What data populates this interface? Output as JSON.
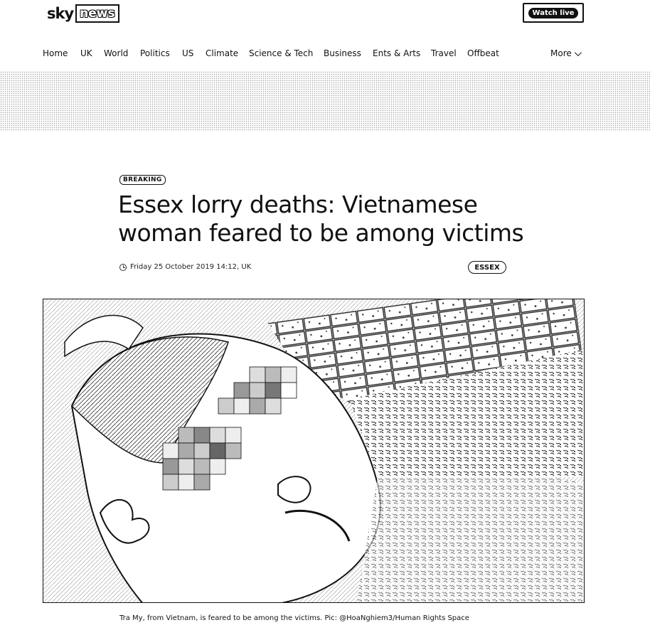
{
  "brand": {
    "sky": "sky",
    "news": "news"
  },
  "header": {
    "watch_live": "Watch live"
  },
  "nav": {
    "items": [
      "Home",
      "UK",
      "World",
      "Politics",
      "US",
      "Climate",
      "Science & Tech",
      "Business",
      "Ents & Arts",
      "Travel",
      "Offbeat"
    ],
    "more": "More"
  },
  "article": {
    "badge": "BREAKING",
    "headline": "Essex lorry deaths: Vietnamese woman feared to be among victims",
    "timestamp": "Friday 25 October 2019 14:12, UK",
    "topic": "ESSEX",
    "caption": "Tra My, from Vietnam, is feared to be among the victims. Pic: @HoaNghiem3/Human Rights Space"
  },
  "icons": {
    "clock": "clock-icon",
    "chevron": "chevron-down-icon"
  }
}
